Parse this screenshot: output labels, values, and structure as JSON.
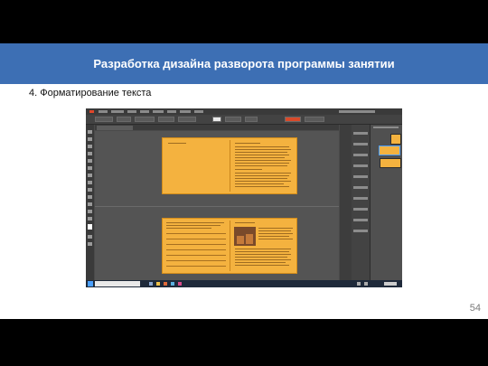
{
  "slide": {
    "title": "Разработка дизайна разворота программы занятии",
    "subtitle": "4. Форматирование текста",
    "page_number": "54"
  },
  "colors": {
    "title_bar": "#3d6fb4",
    "page_fill": "#f4b23f",
    "app_dark": "#4a4a4a"
  },
  "screenshot": {
    "app": "InDesign-like layout editor",
    "icons": [
      "tools-panel",
      "pages-panel",
      "taskbar",
      "search-box",
      "windows-start-icon"
    ]
  }
}
